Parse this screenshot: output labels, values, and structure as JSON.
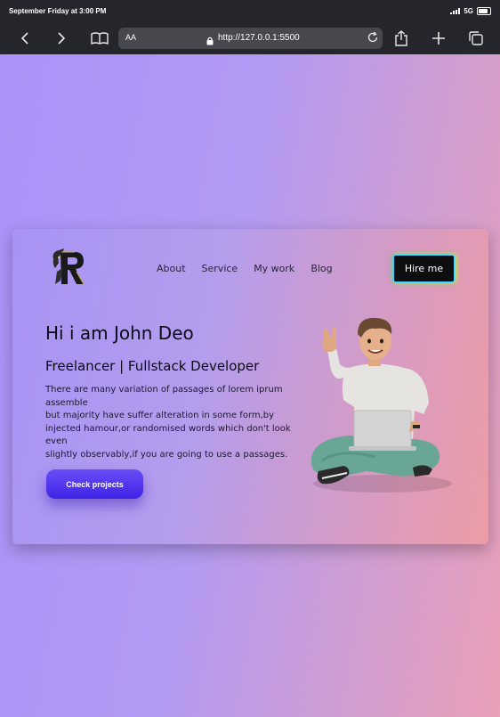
{
  "status": {
    "time": "September Friday at 3:00 PM",
    "network": "5G"
  },
  "browser": {
    "text_size_label": "AA",
    "url": "http://127.0.0.1:5500"
  },
  "nav": {
    "items": [
      "About",
      "Service",
      "My work",
      "Blog"
    ],
    "hire_label": "Hire me"
  },
  "hero": {
    "greeting": "Hi i am John Deo",
    "role": "Freelancer | Fullstack Developer",
    "description": "There are many variation of passages of lorem iprum\nassemble\nbut majority have suffer alteration in some form,by\ninjected hamour,or randomised words which don't look\neven\nslightly observably,if you are going to use a passages.",
    "cta_label": "Check projects"
  },
  "colors": {
    "accent": "#4a2ff0",
    "hire_bg": "#0e0e10"
  }
}
